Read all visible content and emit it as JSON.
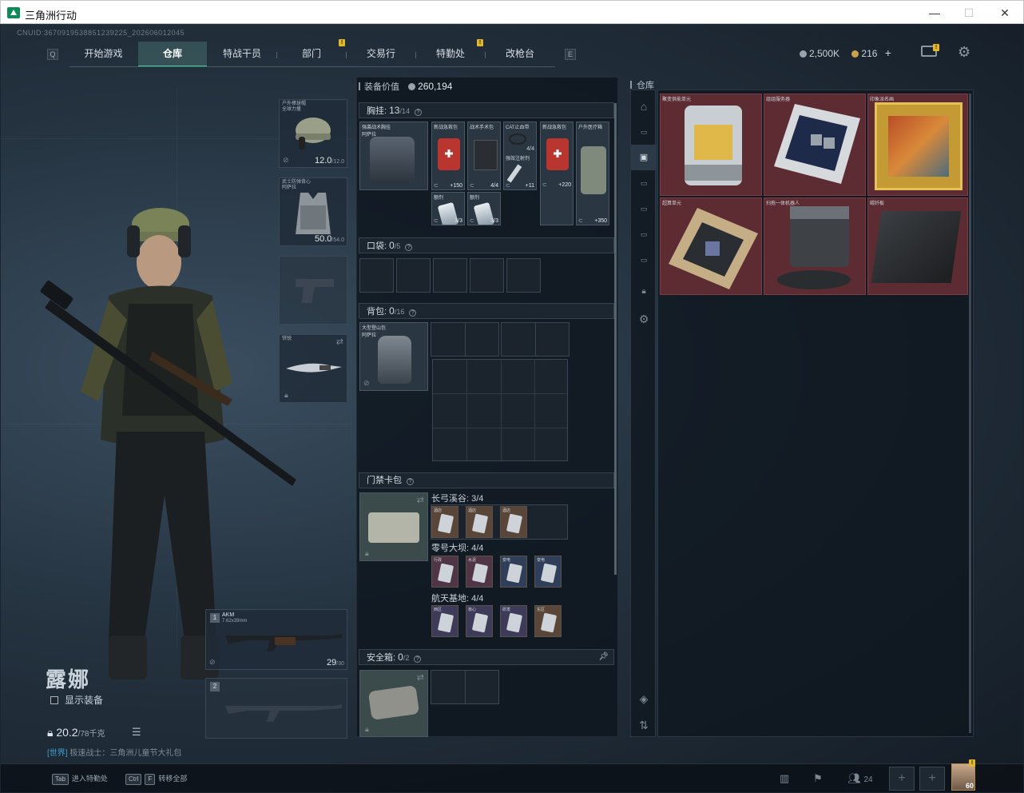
{
  "window": {
    "title": "三角洲行动",
    "minimize": "—",
    "maximize": "☐",
    "close": "✕"
  },
  "uid": "CNUID:3670919538851239225_202606012045",
  "nav": {
    "tabs": [
      {
        "label": "开始游戏"
      },
      {
        "label": "仓库",
        "active": true
      },
      {
        "label": "特战干员"
      },
      {
        "label": "部门",
        "badge": "!"
      },
      {
        "label": "交易行"
      },
      {
        "label": "特勤处",
        "badge": "!"
      },
      {
        "label": "改枪台"
      }
    ],
    "left_key": "Q",
    "right_key": "E"
  },
  "currency": {
    "silver": "2,500K",
    "gold": "216",
    "add": "+",
    "silver_color": "#9aa3ab",
    "gold_color": "#c9a24a"
  },
  "mail_badge": "!",
  "character": {
    "name": "露娜",
    "show_equipment": "显示装备",
    "weight": "20.2",
    "weight_max": "/78千克"
  },
  "chat": {
    "channel": "[世界]",
    "user": "极速战士",
    "message": "三角洲儿童节大礼包"
  },
  "slots": {
    "helmet": {
      "label": "户外棒球帽\n全球力量",
      "value": "12.0",
      "max": "/12.0"
    },
    "armor": {
      "label": "武士防弹背心\n阿萨拉",
      "value": "50.0",
      "max": "/54.0"
    },
    "melee": {
      "label": "铁锐"
    },
    "primary": {
      "index": "1",
      "name": "AKM",
      "caliber": "7.62x39mm",
      "ammo": "29",
      "ammo_max": "/30"
    },
    "secondary": {
      "index": "2"
    }
  },
  "equip": {
    "value_label": "装备价值",
    "value": "260,194",
    "chest": {
      "title": "胸挂:",
      "count": "13",
      "max": "/14"
    },
    "chest_rig": {
      "label": "强袭战术胸挂\n阿萨拉"
    },
    "chest_items": [
      {
        "label": "新战急救包",
        "count": "150",
        "bl": "⊂"
      },
      {
        "label": "战术手术包",
        "count": "4/4",
        "bl": "⊂"
      },
      {
        "label": "CAT止血带",
        "count": "4/4",
        "sub": "强效注射剂",
        "extra": "11",
        "bl": "⊂"
      },
      {
        "label": "新战急救包",
        "count": "220",
        "bl": "⊂"
      },
      {
        "label": "户外医疗箱",
        "count": "350",
        "bl": "⊂"
      },
      {
        "label": "额剂",
        "count": "3/3",
        "bl": "⊂"
      },
      {
        "label": "额剂",
        "count": "3/3",
        "bl": "⊂"
      }
    ],
    "pocket": {
      "title": "口袋:",
      "count": "0",
      "max": "/5"
    },
    "backpack": {
      "title": "背包:",
      "count": "0",
      "max": "/16"
    },
    "backpack_item": {
      "label": "大型登山包\n阿萨拉"
    },
    "keycard": {
      "title": "门禁卡包"
    },
    "keycard_groups": [
      {
        "name": "长弓溪谷",
        "count": "3/4",
        "cards": [
          "酒店",
          "酒店",
          "酒店"
        ]
      },
      {
        "name": "零号大坝",
        "count": "4/4",
        "cards": [
          "行政",
          "水泥",
          "变电",
          "变电"
        ]
      },
      {
        "name": "航天基地",
        "count": "4/4",
        "cards": [
          "西区",
          "核心",
          "研发",
          "东区"
        ]
      }
    ],
    "safe": {
      "title": "安全箱:",
      "count": "0",
      "max": "/2"
    }
  },
  "warehouse": {
    "label": "仓库",
    "items": [
      {
        "label": "聚变供能单元"
      },
      {
        "label": "组组服务器"
      },
      {
        "label": "印象派名画"
      },
      {
        "label": "超算单元"
      },
      {
        "label": "扫拖一体机器人"
      },
      {
        "label": "碳纤板"
      }
    ]
  },
  "bottom": {
    "hint1_key": "Tab",
    "hint1": "进入特勤处",
    "hint2_key1": "Ctrl",
    "hint2_key2": "F",
    "hint2": "转移全部",
    "friends": "24",
    "level": "60",
    "avatar_badge": "!"
  }
}
